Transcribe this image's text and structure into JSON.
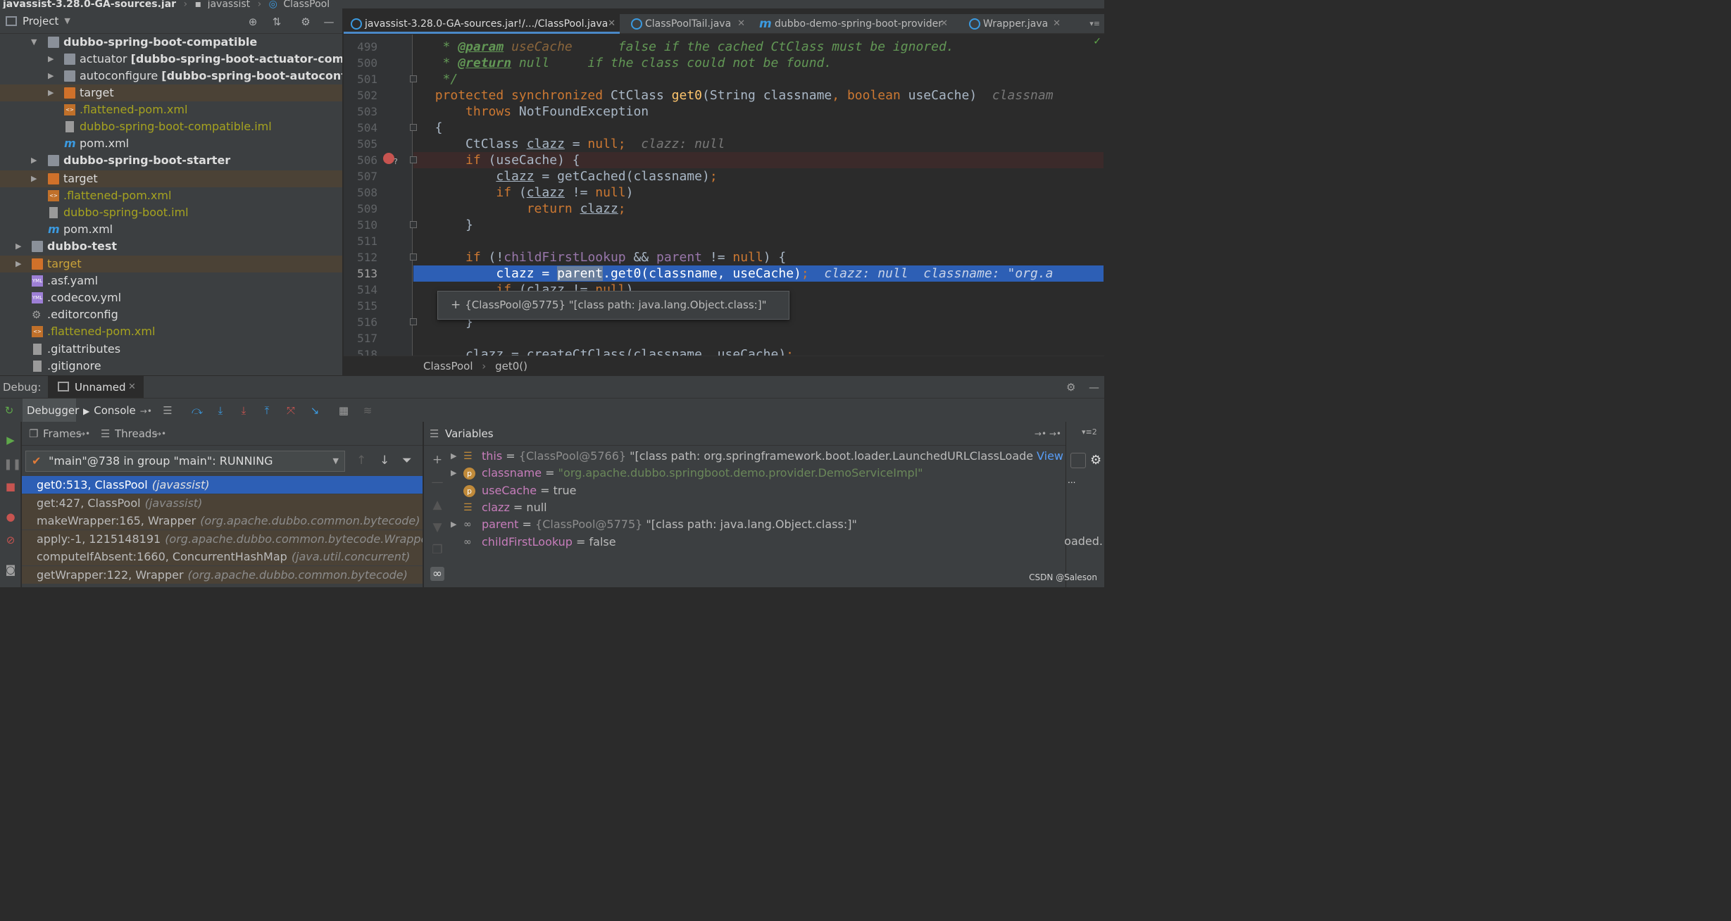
{
  "navbar": {
    "items": [
      "javassist-3.28.0-GA-sources.jar",
      "javassist",
      "ClassPool"
    ]
  },
  "project": {
    "title": "Project",
    "tree": [
      {
        "text": "dubbo-spring-boot-compatible",
        "suffix": ""
      },
      {
        "text": "actuator",
        "suffix": "[dubbo-spring-boot-actuator-compa"
      },
      {
        "text": "autoconfigure",
        "suffix": "[dubbo-spring-boot-autoconfig"
      },
      {
        "text": "target",
        "suffix": ""
      },
      {
        "text": ".flattened-pom.xml",
        "suffix": ""
      },
      {
        "text": "dubbo-spring-boot-compatible.iml",
        "suffix": ""
      },
      {
        "text": "pom.xml",
        "suffix": ""
      },
      {
        "text": "dubbo-spring-boot-starter",
        "suffix": ""
      },
      {
        "text": "target",
        "suffix": ""
      },
      {
        "text": ".flattened-pom.xml",
        "suffix": ""
      },
      {
        "text": "dubbo-spring-boot.iml",
        "suffix": ""
      },
      {
        "text": "pom.xml",
        "suffix": ""
      },
      {
        "text": "dubbo-test",
        "suffix": ""
      },
      {
        "text": "target",
        "suffix": ""
      },
      {
        "text": ".asf.yaml",
        "suffix": ""
      },
      {
        "text": ".codecov.yml",
        "suffix": ""
      },
      {
        "text": ".editorconfig",
        "suffix": ""
      },
      {
        "text": ".flattened-pom.xml",
        "suffix": ""
      },
      {
        "text": ".gitattributes",
        "suffix": ""
      },
      {
        "text": ".gitignore",
        "suffix": ""
      }
    ]
  },
  "tabs": [
    {
      "label": "javassist-3.28.0-GA-sources.jar!/.../ClassPool.java"
    },
    {
      "label": "ClassPoolTail.java"
    },
    {
      "label": "dubbo-demo-spring-boot-provider"
    },
    {
      "label": "Wrapper.java"
    }
  ],
  "editor": {
    "line_numbers": [
      "499",
      "500",
      "501",
      "502",
      "503",
      "504",
      "505",
      "506",
      "507",
      "508",
      "509",
      "510",
      "511",
      "512",
      "513",
      "514",
      "515",
      "516",
      "517",
      "518"
    ],
    "current_line": "513",
    "tooltip": "{ClassPool@5775} \"[class path: java.lang.Object.class:]\"",
    "tooltip_plus": "+",
    "breadcrumb": [
      "ClassPool",
      "get0()"
    ]
  },
  "debug": {
    "label": "Debug:",
    "session": "Unnamed",
    "tab_debugger": "Debugger",
    "tab_console": "Console",
    "frames_tab": "Frames",
    "threads_tab": "Threads",
    "variables_title": "Variables",
    "thread_selector": "\"main\"@738 in group \"main\": RUNNING",
    "frames": [
      {
        "method": "get0:513, ClassPool",
        "pkg": "(javassist)"
      },
      {
        "method": "get:427, ClassPool",
        "pkg": "(javassist)"
      },
      {
        "method": "makeWrapper:165, Wrapper",
        "pkg": "(org.apache.dubbo.common.bytecode)"
      },
      {
        "method": "apply:-1, 1215148191",
        "pkg": "(org.apache.dubbo.common.bytecode.Wrapper$"
      },
      {
        "method": "computeIfAbsent:1660, ConcurrentHashMap",
        "pkg": "(java.util.concurrent)"
      },
      {
        "method": "getWrapper:122, Wrapper",
        "pkg": "(org.apache.dubbo.common.bytecode)"
      }
    ],
    "variables": [
      {
        "name": "this",
        "eq": " = ",
        "obj": "{ClassPool@5766}",
        "val": " \"[class path: org.springframework.boot.loader.LaunchedURLClassLoade",
        "link": "View"
      },
      {
        "name": "classname",
        "eq": " = ",
        "obj": "",
        "val": "\"org.apache.dubbo.springboot.demo.provider.DemoServiceImpl\"",
        "link": ""
      },
      {
        "name": "useCache",
        "eq": " = ",
        "obj": "",
        "val": "true",
        "link": ""
      },
      {
        "name": "clazz",
        "eq": " = ",
        "obj": "",
        "val": "null",
        "link": ""
      },
      {
        "name": "parent",
        "eq": " = ",
        "obj": "{ClassPool@5775}",
        "val": " \"[class path: java.lang.Object.class:]\"",
        "link": ""
      },
      {
        "name": "childFirstLookup",
        "eq": " = ",
        "obj": "",
        "val": "false",
        "link": ""
      }
    ],
    "right_snippet": "oaded.",
    "watermark": "CSDN @Saleson"
  },
  "colors": {
    "accent": "#2d5fb5",
    "breakpoint": "#c75450",
    "keyword": "#cc7832",
    "comment": "#629755"
  }
}
